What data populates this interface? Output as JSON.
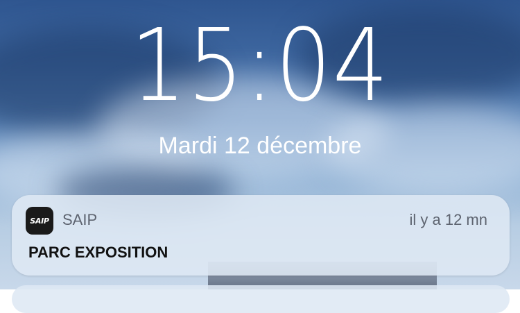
{
  "lock_screen": {
    "time": "15:04",
    "date": "Mardi 12 décembre"
  },
  "notification": {
    "app_icon": "saip-app-icon",
    "app_icon_text": "SAIP",
    "app_name": "SAIP",
    "time_ago": "il y a 12 mn",
    "title": "PARC EXPOSITION"
  }
}
